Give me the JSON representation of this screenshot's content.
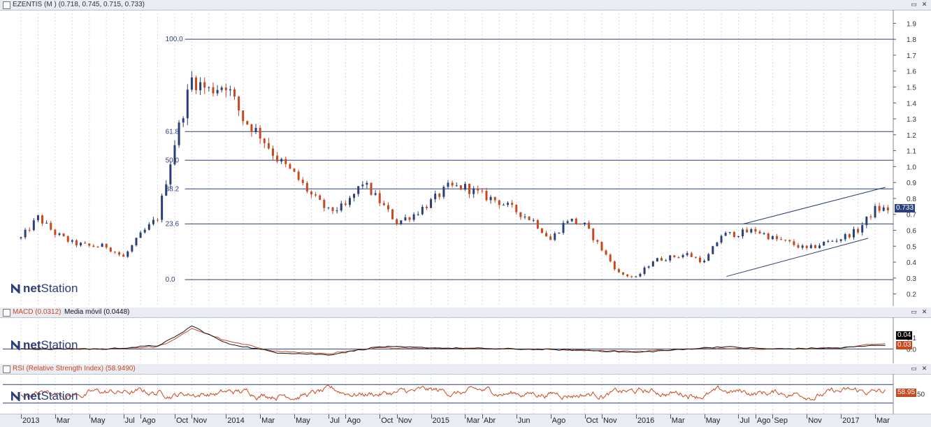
{
  "main": {
    "title": "EZENTIS (M )",
    "ohlc_text": "(0.718, 0.745, 0.715, 0.733)",
    "last_value": "0.733",
    "y_ticks": [
      "1.9",
      "1.8",
      "1.7",
      "1.6",
      "1.5",
      "1.4",
      "1.3",
      "1.2",
      "1.1",
      "1.0",
      "0.9",
      "0.8",
      "0.7",
      "0.6",
      "0.5",
      "0.4",
      "0.3",
      "0.2"
    ],
    "fib_labels": [
      "100.0",
      "61.8",
      "50.0",
      "38.2",
      "23.6",
      "0.0"
    ]
  },
  "macd": {
    "title": "MACD (0.0312)",
    "ma_title": "Media móvil (0.0448)",
    "y_ticks": [
      "0.1",
      "0.0"
    ],
    "box_black": "0.04",
    "box_red": "0.03"
  },
  "rsi": {
    "title": "RSI (Relative Strength Index) (58.9490)",
    "y_ticks": [
      "50"
    ],
    "box_red": "58.95"
  },
  "logo": {
    "brand_bold": "net",
    "brand_rest": "Station"
  },
  "x_labels": [
    "2013",
    "Mar",
    "May",
    "Jul",
    "Ago",
    "Oct",
    "Nov",
    "2014",
    "Mar",
    "May",
    "Jul",
    "Ago",
    "Oct",
    "Nov",
    "2015",
    "Mar",
    "Abr",
    "Jun",
    "Ago",
    "Oct",
    "Nov",
    "2016",
    "Mar",
    "May",
    "Jul",
    "Ago",
    "Sep",
    "Nov",
    "2017",
    "Mar"
  ],
  "colors": {
    "up": "#2b3f7a",
    "down": "#c8481f",
    "line": "#2b3f7a",
    "rsi": "#c8481f",
    "macd": "#111111",
    "signal": "#c8481f"
  },
  "chart_data": [
    {
      "type": "candlestick",
      "title": "EZENTIS (M )",
      "ylim": [
        0.15,
        1.95
      ],
      "x_range": [
        "2013-01",
        "2017-03"
      ],
      "series": [
        {
          "name": "EZENTIS (M )",
          "x": [
            "2013-01",
            "2013-02",
            "2013-03",
            "2013-04",
            "2013-05",
            "2013-06",
            "2013-07",
            "2013-08",
            "2013-09",
            "2013-10",
            "2013-11",
            "2013-12",
            "2014-01",
            "2014-02",
            "2014-03",
            "2014-04",
            "2014-05",
            "2014-06",
            "2014-07",
            "2014-08",
            "2014-09",
            "2014-10",
            "2014-11",
            "2014-12",
            "2015-01",
            "2015-02",
            "2015-03",
            "2015-04",
            "2015-05",
            "2015-06",
            "2015-07",
            "2015-08",
            "2015-09",
            "2015-10",
            "2015-11",
            "2015-12",
            "2016-01",
            "2016-02",
            "2016-03",
            "2016-04",
            "2016-05",
            "2016-06",
            "2016-07",
            "2016-08",
            "2016-09",
            "2016-10",
            "2016-11",
            "2016-12",
            "2017-01",
            "2017-02",
            "2017-03"
          ],
          "close": [
            0.55,
            0.68,
            0.58,
            0.52,
            0.5,
            0.5,
            0.43,
            0.57,
            0.68,
            1.15,
            1.55,
            1.48,
            1.52,
            1.3,
            1.2,
            1.05,
            0.95,
            0.82,
            0.72,
            0.75,
            0.9,
            0.78,
            0.65,
            0.7,
            0.78,
            0.87,
            0.87,
            0.82,
            0.78,
            0.72,
            0.66,
            0.54,
            0.67,
            0.63,
            0.48,
            0.33,
            0.3,
            0.41,
            0.43,
            0.45,
            0.4,
            0.57,
            0.58,
            0.6,
            0.55,
            0.52,
            0.48,
            0.52,
            0.55,
            0.6,
            0.733
          ]
        }
      ],
      "fibonacci": {
        "levels": [
          {
            "label": "100.0",
            "value": 1.8
          },
          {
            "label": "61.8",
            "value": 1.22
          },
          {
            "label": "50.0",
            "value": 1.04
          },
          {
            "label": "38.2",
            "value": 0.86
          },
          {
            "label": "23.6",
            "value": 0.64
          },
          {
            "label": "0.0",
            "value": 0.29
          }
        ]
      },
      "channel": {
        "upper": [
          {
            "x": "2016-07",
            "y": 0.64
          },
          {
            "x": "2017-03",
            "y": 0.87
          }
        ],
        "lower": [
          {
            "x": "2016-06",
            "y": 0.31
          },
          {
            "x": "2017-02",
            "y": 0.55
          }
        ]
      }
    },
    {
      "type": "line",
      "title": "MACD (0.0312)",
      "ylim": [
        -0.1,
        0.25
      ],
      "series": [
        {
          "name": "MACD",
          "x": [
            "2013-01",
            "2013-06",
            "2013-09",
            "2013-10",
            "2013-11",
            "2014-01",
            "2014-04",
            "2014-07",
            "2014-10",
            "2015-01",
            "2015-06",
            "2015-10",
            "2016-01",
            "2016-06",
            "2016-09",
            "2017-01",
            "2017-03"
          ],
          "values": [
            0.0,
            0.0,
            0.03,
            0.1,
            0.2,
            0.05,
            -0.03,
            -0.05,
            0.02,
            0.01,
            0.0,
            -0.01,
            -0.03,
            0.02,
            0.0,
            0.01,
            0.0312
          ]
        },
        {
          "name": "Media móvil",
          "x": [
            "2013-01",
            "2013-06",
            "2013-09",
            "2013-10",
            "2013-11",
            "2014-01",
            "2014-04",
            "2014-07",
            "2014-10",
            "2015-01",
            "2015-06",
            "2015-10",
            "2016-01",
            "2016-06",
            "2016-09",
            "2017-01",
            "2017-03"
          ],
          "values": [
            0.0,
            0.0,
            0.02,
            0.08,
            0.18,
            0.07,
            -0.02,
            -0.04,
            0.01,
            0.01,
            0.0,
            -0.01,
            -0.02,
            0.01,
            0.0,
            0.01,
            0.0448
          ]
        }
      ]
    },
    {
      "type": "line",
      "title": "RSI (Relative Strength Index) (58.9490)",
      "ylim": [
        10,
        90
      ],
      "series": [
        {
          "name": "RSI",
          "x": [
            "2013-01",
            "2017-03"
          ],
          "last": 58.949
        }
      ]
    }
  ]
}
